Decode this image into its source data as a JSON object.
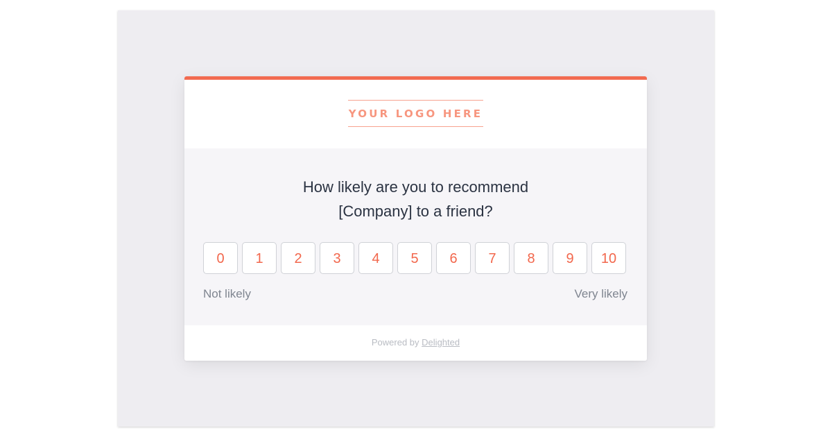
{
  "survey": {
    "logo_text": "YOUR LOGO HERE",
    "question_line1": "How likely are you to recommend",
    "question_line2": "[Company] to a friend?",
    "scores": [
      "0",
      "1",
      "2",
      "3",
      "4",
      "5",
      "6",
      "7",
      "8",
      "9",
      "10"
    ],
    "low_label": "Not likely",
    "high_label": "Very likely"
  },
  "footer": {
    "powered_by": "Powered by",
    "brand_link": "Delighted"
  },
  "colors": {
    "accent": "#f26b50",
    "logo": "#f7967f",
    "background_frame": "#eeedf1",
    "card_body": "#f6f5f8"
  }
}
